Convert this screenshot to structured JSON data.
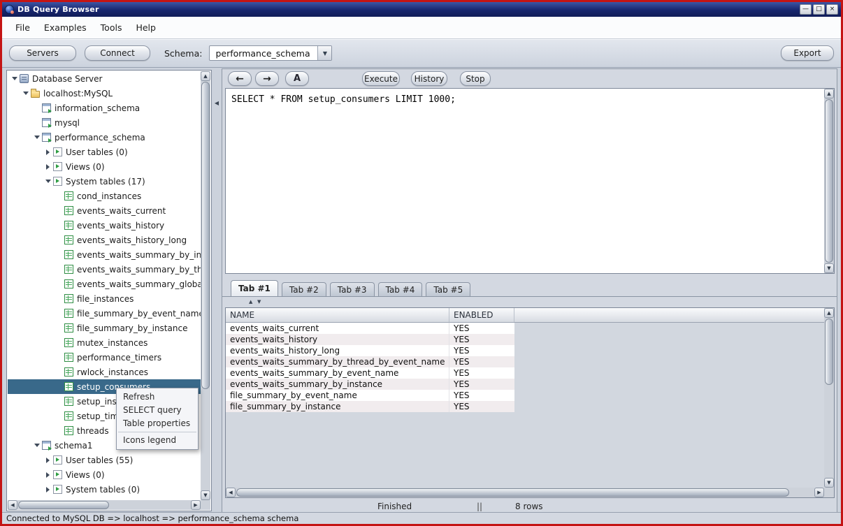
{
  "window": {
    "title": "DB Query Browser",
    "status_bar": "Connected to MySQL DB => localhost => performance_schema schema"
  },
  "icons": {
    "minimize": "—",
    "maximize": "□",
    "close": "×",
    "back": "←",
    "forward": "→",
    "font": "A",
    "combo_arrow": "▼",
    "divider_collapse": "◀",
    "splitter_up": "▲",
    "splitter_down": "▼",
    "scroll_up": "▲",
    "scroll_down": "▼",
    "scroll_left": "◀",
    "scroll_right": "▶"
  },
  "menu_bar": {
    "items": [
      "File",
      "Examples",
      "Tools",
      "Help"
    ]
  },
  "toolbar": {
    "servers_label": "Servers",
    "connect_label": "Connect",
    "schema_label": "Schema:",
    "schema_value": "performance_schema",
    "export_label": "Export"
  },
  "tree": {
    "nodes": [
      {
        "label": "Database Server",
        "depth": 0,
        "expander": "open",
        "icon": "server",
        "selected": false
      },
      {
        "label": "localhost:MySQL",
        "depth": 1,
        "expander": "open",
        "icon": "folder",
        "selected": false
      },
      {
        "label": "information_schema",
        "depth": 2,
        "expander": "none",
        "icon": "schema",
        "selected": false
      },
      {
        "label": "mysql",
        "depth": 2,
        "expander": "none",
        "icon": "schema",
        "selected": false
      },
      {
        "label": "performance_schema",
        "depth": 2,
        "expander": "open",
        "icon": "schema",
        "selected": false
      },
      {
        "label": "User tables (0)",
        "depth": 3,
        "expander": "closed",
        "icon": "category",
        "selected": false
      },
      {
        "label": "Views (0)",
        "depth": 3,
        "expander": "closed",
        "icon": "category",
        "selected": false
      },
      {
        "label": "System tables (17)",
        "depth": 3,
        "expander": "open",
        "icon": "category",
        "selected": false
      },
      {
        "label": "cond_instances",
        "depth": 4,
        "expander": "none",
        "icon": "table",
        "selected": false
      },
      {
        "label": "events_waits_current",
        "depth": 4,
        "expander": "none",
        "icon": "table",
        "selected": false
      },
      {
        "label": "events_waits_history",
        "depth": 4,
        "expander": "none",
        "icon": "table",
        "selected": false
      },
      {
        "label": "events_waits_history_long",
        "depth": 4,
        "expander": "none",
        "icon": "table",
        "selected": false
      },
      {
        "label": "events_waits_summary_by_instance",
        "depth": 4,
        "expander": "none",
        "icon": "table",
        "selected": false
      },
      {
        "label": "events_waits_summary_by_thread_by_event_name",
        "depth": 4,
        "expander": "none",
        "icon": "table",
        "selected": false
      },
      {
        "label": "events_waits_summary_global_by_event_name",
        "depth": 4,
        "expander": "none",
        "icon": "table",
        "selected": false
      },
      {
        "label": "file_instances",
        "depth": 4,
        "expander": "none",
        "icon": "table",
        "selected": false
      },
      {
        "label": "file_summary_by_event_name",
        "depth": 4,
        "expander": "none",
        "icon": "table",
        "selected": false
      },
      {
        "label": "file_summary_by_instance",
        "depth": 4,
        "expander": "none",
        "icon": "table",
        "selected": false
      },
      {
        "label": "mutex_instances",
        "depth": 4,
        "expander": "none",
        "icon": "table",
        "selected": false
      },
      {
        "label": "performance_timers",
        "depth": 4,
        "expander": "none",
        "icon": "table",
        "selected": false
      },
      {
        "label": "rwlock_instances",
        "depth": 4,
        "expander": "none",
        "icon": "table",
        "selected": false
      },
      {
        "label": "setup_consumers",
        "depth": 4,
        "expander": "none",
        "icon": "table",
        "selected": true
      },
      {
        "label": "setup_instruments",
        "depth": 4,
        "expander": "none",
        "icon": "table",
        "selected": false
      },
      {
        "label": "setup_timers",
        "depth": 4,
        "expander": "none",
        "icon": "table",
        "selected": false
      },
      {
        "label": "threads",
        "depth": 4,
        "expander": "none",
        "icon": "table",
        "selected": false
      },
      {
        "label": "schema1",
        "depth": 2,
        "expander": "open",
        "icon": "schema",
        "selected": false
      },
      {
        "label": "User tables (55)",
        "depth": 3,
        "expander": "closed",
        "icon": "category",
        "selected": false
      },
      {
        "label": "Views (0)",
        "depth": 3,
        "expander": "closed",
        "icon": "category",
        "selected": false
      },
      {
        "label": "System tables (0)",
        "depth": 3,
        "expander": "closed",
        "icon": "category",
        "selected": false
      }
    ]
  },
  "context_menu": {
    "items": [
      {
        "label": "Refresh",
        "separator_before": false
      },
      {
        "label": "SELECT query",
        "separator_before": false
      },
      {
        "label": "Table properties",
        "separator_before": false
      },
      {
        "label": "Icons legend",
        "separator_before": true
      }
    ]
  },
  "query_panel": {
    "execute_label": "Execute",
    "history_label": "History",
    "stop_label": "Stop",
    "sql": "SELECT * FROM setup_consumers LIMIT 1000;"
  },
  "tabs": {
    "items": [
      "Tab #1",
      "Tab #2",
      "Tab #3",
      "Tab #4",
      "Tab #5"
    ],
    "selected": "Tab #1"
  },
  "results": {
    "columns": [
      "NAME",
      "ENABLED"
    ],
    "rows": [
      {
        "name": "events_waits_current",
        "enabled": "YES"
      },
      {
        "name": "events_waits_history",
        "enabled": "YES"
      },
      {
        "name": "events_waits_history_long",
        "enabled": "YES"
      },
      {
        "name": "events_waits_summary_by_thread_by_event_name",
        "enabled": "YES"
      },
      {
        "name": "events_waits_summary_by_event_name",
        "enabled": "YES"
      },
      {
        "name": "events_waits_summary_by_instance",
        "enabled": "YES"
      },
      {
        "name": "file_summary_by_event_name",
        "enabled": "YES"
      },
      {
        "name": "file_summary_by_instance",
        "enabled": "YES"
      }
    ],
    "status": {
      "state": "Finished",
      "separator": "||",
      "row_count": "8 rows"
    }
  }
}
